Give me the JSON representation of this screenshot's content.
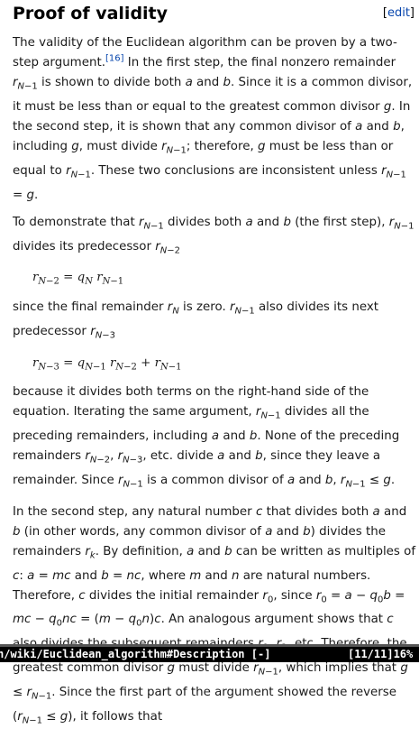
{
  "section": {
    "title": "Proof of validity",
    "edit_label": "[edit]",
    "edit_link": "edit",
    "edit_open": "[",
    "edit_close": "]"
  },
  "citation": "[16]",
  "paragraphs": {
    "p1": "The validity of the Euclidean algorithm can be proven by a two-step argument.",
    "p2": "To demonstrate that",
    "p3": "since the final remainder",
    "p4": "because it divides both terms on the right-hand side of the equation.",
    "p5": "In the second step, any natural number"
  },
  "status_bar": {
    "url": "n/wiki/Euclidean_algorithm#Description [-]",
    "position": "[11/11]16%"
  }
}
